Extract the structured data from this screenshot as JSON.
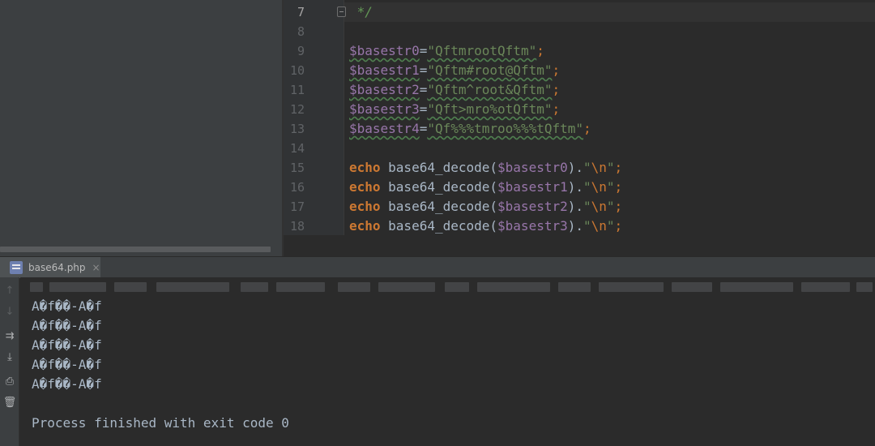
{
  "editor": {
    "lines": [
      {
        "num": "7",
        "tokens": [
          {
            "t": "cmt",
            "v": " */"
          }
        ]
      },
      {
        "num": "8",
        "tokens": []
      },
      {
        "num": "9",
        "tokens": [
          {
            "t": "var-u",
            "v": "$basestr0"
          },
          {
            "t": "op",
            "v": "="
          },
          {
            "t": "str-u",
            "v": "\"QftmrootQftm\""
          },
          {
            "t": "semi",
            "v": ";"
          }
        ]
      },
      {
        "num": "10",
        "tokens": [
          {
            "t": "var-u",
            "v": "$basestr1"
          },
          {
            "t": "op",
            "v": "="
          },
          {
            "t": "str-u",
            "v": "\"Qftm#root@Qftm\""
          },
          {
            "t": "semi",
            "v": ";"
          }
        ]
      },
      {
        "num": "11",
        "tokens": [
          {
            "t": "var-u",
            "v": "$basestr2"
          },
          {
            "t": "op",
            "v": "="
          },
          {
            "t": "str-u",
            "v": "\"Qftm^root&Qftm\""
          },
          {
            "t": "semi",
            "v": ";"
          }
        ]
      },
      {
        "num": "12",
        "tokens": [
          {
            "t": "var-u",
            "v": "$basestr3"
          },
          {
            "t": "op",
            "v": "="
          },
          {
            "t": "str-u",
            "v": "\"Qft>mro%otQftm\""
          },
          {
            "t": "semi",
            "v": ";"
          }
        ]
      },
      {
        "num": "13",
        "tokens": [
          {
            "t": "var-u",
            "v": "$basestr4"
          },
          {
            "t": "op",
            "v": "="
          },
          {
            "t": "str-u",
            "v": "\"Qf%%%tmroo%%%tQftm\""
          },
          {
            "t": "semi",
            "v": ";"
          }
        ]
      },
      {
        "num": "14",
        "tokens": []
      },
      {
        "num": "15",
        "tokens": [
          {
            "t": "kw",
            "v": "echo"
          },
          {
            "t": "op",
            "v": " base64_decode("
          },
          {
            "t": "var",
            "v": "$basestr0"
          },
          {
            "t": "op",
            "v": ")."
          },
          {
            "t": "str",
            "v": "\""
          },
          {
            "t": "esc",
            "v": "\\n"
          },
          {
            "t": "str",
            "v": "\""
          },
          {
            "t": "semi",
            "v": ";"
          }
        ]
      },
      {
        "num": "16",
        "tokens": [
          {
            "t": "kw",
            "v": "echo"
          },
          {
            "t": "op",
            "v": " base64_decode("
          },
          {
            "t": "var",
            "v": "$basestr1"
          },
          {
            "t": "op",
            "v": ")."
          },
          {
            "t": "str",
            "v": "\""
          },
          {
            "t": "esc",
            "v": "\\n"
          },
          {
            "t": "str",
            "v": "\""
          },
          {
            "t": "semi",
            "v": ";"
          }
        ]
      },
      {
        "num": "17",
        "tokens": [
          {
            "t": "kw",
            "v": "echo"
          },
          {
            "t": "op",
            "v": " base64_decode("
          },
          {
            "t": "var",
            "v": "$basestr2"
          },
          {
            "t": "op",
            "v": ")."
          },
          {
            "t": "str",
            "v": "\""
          },
          {
            "t": "esc",
            "v": "\\n"
          },
          {
            "t": "str",
            "v": "\""
          },
          {
            "t": "semi",
            "v": ";"
          }
        ]
      },
      {
        "num": "18",
        "tokens": [
          {
            "t": "kw",
            "v": "echo"
          },
          {
            "t": "op",
            "v": " base64_decode("
          },
          {
            "t": "var",
            "v": "$basestr3"
          },
          {
            "t": "op",
            "v": ")."
          },
          {
            "t": "str",
            "v": "\""
          },
          {
            "t": "esc",
            "v": "\\n"
          },
          {
            "t": "str",
            "v": "\""
          },
          {
            "t": "semi",
            "v": ";"
          }
        ]
      }
    ]
  },
  "run_tab": {
    "label": "base64.php",
    "close": "×",
    "icon": "php-file-icon"
  },
  "toolbar": [
    {
      "name": "scroll-up-icon",
      "glyph": "↑",
      "dim": true
    },
    {
      "name": "scroll-down-icon",
      "glyph": "↓",
      "dim": true
    },
    {
      "name": "soft-wrap-icon",
      "glyph": "⇉",
      "dim": false
    },
    {
      "name": "scroll-to-end-icon",
      "glyph": "⤓",
      "dim": false
    },
    {
      "name": "print-icon",
      "glyph": "⎙",
      "dim": false
    },
    {
      "name": "trash-icon",
      "glyph": "🗑",
      "dim": false
    }
  ],
  "console": {
    "output": [
      "A�f��-A�f",
      "A�f��-A�f",
      "A�f��-A�f",
      "A�f��-A�f",
      "A�f��-A�f",
      "",
      "Process finished with exit code 0"
    ]
  }
}
